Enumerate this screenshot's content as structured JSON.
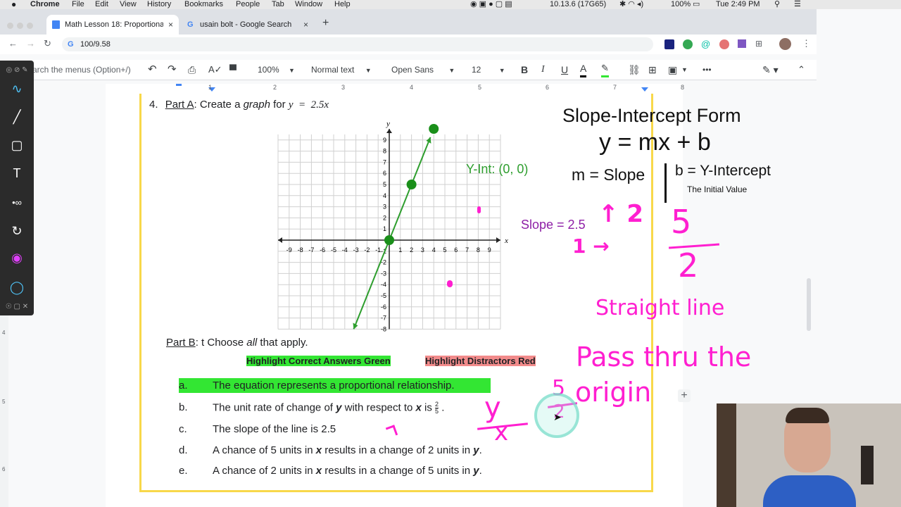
{
  "menubar": {
    "apple": "",
    "items": [
      "Chrome",
      "File",
      "Edit",
      "View",
      "History",
      "Bookmarks",
      "People",
      "Tab",
      "Window",
      "Help"
    ],
    "status": {
      "build": "10.13.6 (17G65)",
      "battery": "100%",
      "clock": "Tue 2:49 PM"
    }
  },
  "tabs": [
    {
      "title": "Math Lesson 18: Proportional R",
      "close": "×"
    },
    {
      "title": "usain bolt - Google Search",
      "close": "×"
    }
  ],
  "new_tab": "+",
  "omnibox": {
    "url": "100/9.58"
  },
  "docs_toolbar": {
    "search_menus": "arch the menus (Option+/)",
    "zoom": "100%",
    "style": "Normal text",
    "font": "Open Sans",
    "size": "12",
    "bold": "B",
    "italic": "I",
    "underline": "U",
    "text_color": "A",
    "more": "•••"
  },
  "ruler": {
    "numbers": [
      "1",
      "2",
      "3",
      "4",
      "5",
      "6",
      "7",
      "8"
    ]
  },
  "vruler": {
    "numbers": [
      "4",
      "5",
      "6"
    ]
  },
  "question": {
    "number": "4.",
    "part_a_label": "Part A",
    "part_a_text_1": ": Create a ",
    "part_a_graph": "graph",
    "part_a_text_2": " for ",
    "equation": "y  =  2.5x",
    "part_b_label": "Part B",
    "part_b_text_1": ": t Choose ",
    "part_b_all": "all",
    "part_b_text_2": " that apply.",
    "highlight_green": "Highlight Correct Answers Green",
    "highlight_red": "Highlight Distractors Red",
    "options": [
      {
        "letter": "a.",
        "text": "The equation represents a proportional relationship."
      },
      {
        "letter": "b.",
        "text_1": "The unit rate of change of ",
        "var1": "y",
        "text_2": " with respect to ",
        "var2": "x",
        "text_3": " is ",
        "frac_num": "2",
        "frac_den": "5",
        "text_4": " ."
      },
      {
        "letter": "c.",
        "text": "The slope of the line is 2.5"
      },
      {
        "letter": "d.",
        "text_1": "A chance of 5 units in ",
        "var1": "x",
        "text_2": " results in a change of 2 units in ",
        "var2": "y",
        "text_3": "."
      },
      {
        "letter": "e.",
        "text_1": "A chance of 2 units in ",
        "var1": "x",
        "text_2": " results in a change of 5 units in ",
        "var2": "y",
        "text_3": "."
      }
    ]
  },
  "graph": {
    "x_axis_label": "x",
    "y_axis_label": "y",
    "x_ticks": [
      "-9",
      "-8",
      "-7",
      "-6",
      "-5",
      "-4",
      "-3",
      "-2",
      "-1",
      "1",
      "2",
      "3",
      "4",
      "5",
      "6",
      "7",
      "8",
      "9"
    ],
    "y_ticks_pos": [
      "1",
      "2",
      "3",
      "4",
      "5",
      "6",
      "7",
      "8",
      "9"
    ],
    "y_ticks_neg": [
      "-1",
      "-2",
      "-3",
      "-4",
      "-5",
      "-6",
      "-7",
      "-8"
    ],
    "points": [
      [
        0,
        0
      ],
      [
        2,
        5
      ],
      [
        4,
        10
      ]
    ],
    "line_color": "#2e9e2e",
    "xlim": [
      -9.5,
      9.5
    ],
    "ylim": [
      -8,
      10
    ]
  },
  "notes": {
    "yint": "Y-Int: (0, 0)",
    "slope": "Slope = 2.5",
    "form_title": "Slope-Intercept Form",
    "form_eq": "y = mx + b",
    "m_label": "m = Slope",
    "b_label": "b = Y-Intercept",
    "b_sub": "The Initial Value"
  },
  "handwriting": {
    "up_two": "↑ 2",
    "one_right": "1 →",
    "five": "5",
    "two": "2",
    "straight": "Straight line",
    "pass": "Pass thru the",
    "origin": "origin",
    "y": "y",
    "x": "x",
    "five_b": "5",
    "two_b": "2"
  },
  "colors": {
    "green_text": "#2e9e2e",
    "purple": "#8e1fa6",
    "magenta": "#ff1fd0",
    "highlight_green": "#33e633",
    "highlight_red": "#f28b8b",
    "border_yellow": "#f8d84a"
  }
}
